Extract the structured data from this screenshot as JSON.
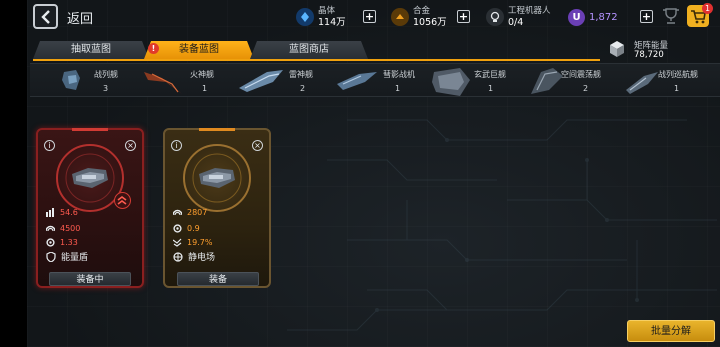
{
  "topbar": {
    "back_label": "返回",
    "resources": [
      {
        "name": "晶体",
        "value": "114万",
        "icon": "crystal-icon",
        "color": "#3aa0ff"
      },
      {
        "name": "合金",
        "value": "1056万",
        "icon": "alloy-icon",
        "color": "#f0a020"
      },
      {
        "name": "工程机器人",
        "value": "0/4",
        "icon": "robot-icon",
        "color": "#d8dde2"
      }
    ],
    "premium": {
      "symbol": "U",
      "value": "1,872",
      "color": "#b493ff"
    },
    "cart_badge": "1"
  },
  "tabs": [
    {
      "label": "抽取蓝图",
      "active": false
    },
    {
      "label": "装备蓝图",
      "active": true,
      "alert": "!"
    },
    {
      "label": "蓝图商店",
      "active": false
    }
  ],
  "energy": {
    "name": "矩阵能量",
    "value": "78,720"
  },
  "ships": [
    {
      "name": "战列舰",
      "count": "3"
    },
    {
      "name": "火神舰",
      "count": "1"
    },
    {
      "name": "雷神舰",
      "count": "2"
    },
    {
      "name": "彗影战机",
      "count": "1"
    },
    {
      "name": "玄武巨舰",
      "count": "1"
    },
    {
      "name": "空间震荡舰",
      "count": "2"
    },
    {
      "name": "战列巡航舰",
      "count": "1"
    }
  ],
  "cards": [
    {
      "theme": "red",
      "stats": [
        {
          "icon": "attack-bars-icon",
          "value": "54.6"
        },
        {
          "icon": "shield-arc-icon",
          "value": "4500"
        },
        {
          "icon": "gear-icon",
          "value": "1.33"
        }
      ],
      "skill": {
        "icon": "energy-shield-icon",
        "label": "能量盾"
      },
      "button": "装备中"
    },
    {
      "theme": "gold",
      "stats": [
        {
          "icon": "shield-arc-icon",
          "value": "2807"
        },
        {
          "icon": "gear-icon",
          "value": "0.9"
        },
        {
          "icon": "wings-icon",
          "value": "19.7%"
        }
      ],
      "skill": {
        "icon": "static-field-icon",
        "label": "静电场"
      },
      "button": "装备"
    }
  ],
  "batch_button": "批量分解"
}
